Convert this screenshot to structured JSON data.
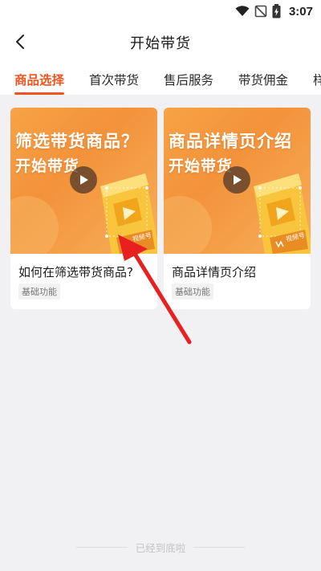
{
  "status_bar": {
    "time": "3:07",
    "icons": [
      "wifi-icon",
      "no-signal-icon",
      "battery-charging-icon"
    ]
  },
  "nav": {
    "title": "开始带货",
    "back_icon": "chevron-left-icon"
  },
  "tabs": [
    {
      "label": "商品选择",
      "active": true
    },
    {
      "label": "首次带货",
      "active": false
    },
    {
      "label": "售后服务",
      "active": false
    },
    {
      "label": "带货佣金",
      "active": false
    },
    {
      "label": "样",
      "active": false
    }
  ],
  "cards": [
    {
      "thumb_line1": "筛选带货商品？",
      "thumb_line2": "开始带货",
      "thumb_badge": "视频号",
      "title": "如何在筛选带货商品?",
      "tag": "基础功能"
    },
    {
      "thumb_line1": "商品详情页介绍",
      "thumb_line2": "开始带货",
      "thumb_badge": "视频号",
      "title": "商品详情页介绍",
      "tag": "基础功能"
    }
  ],
  "footer": {
    "text": "已经到底啦"
  },
  "colors": {
    "accent": "#f2541f",
    "annotation_arrow": "#e8201f"
  }
}
